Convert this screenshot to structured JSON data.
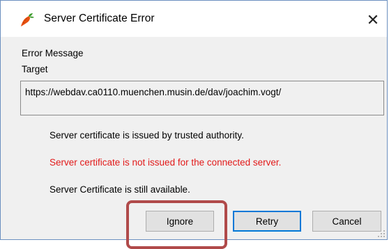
{
  "window": {
    "title": "Server Certificate Error",
    "close_glyph": "✕",
    "icon": "carrot-icon"
  },
  "content": {
    "error_message_label": "Error Message",
    "target_label": "Target",
    "target_url": "https://webdav.ca0110.muenchen.musin.de/dav/joachim.vogt/"
  },
  "messages": [
    {
      "text": "Server certificate is issued by trusted authority.",
      "color": "#000000"
    },
    {
      "text": "Server certificate is not issued for the connected server.",
      "color": "#e21a1a"
    },
    {
      "text": "Server Certificate is still available.",
      "color": "#000000"
    }
  ],
  "buttons": {
    "ignore": "Ignore",
    "retry": "Retry",
    "cancel": "Cancel"
  },
  "colors": {
    "accent": "#0078d7",
    "error_text": "#e21a1a",
    "highlight": "#b04a4a"
  }
}
